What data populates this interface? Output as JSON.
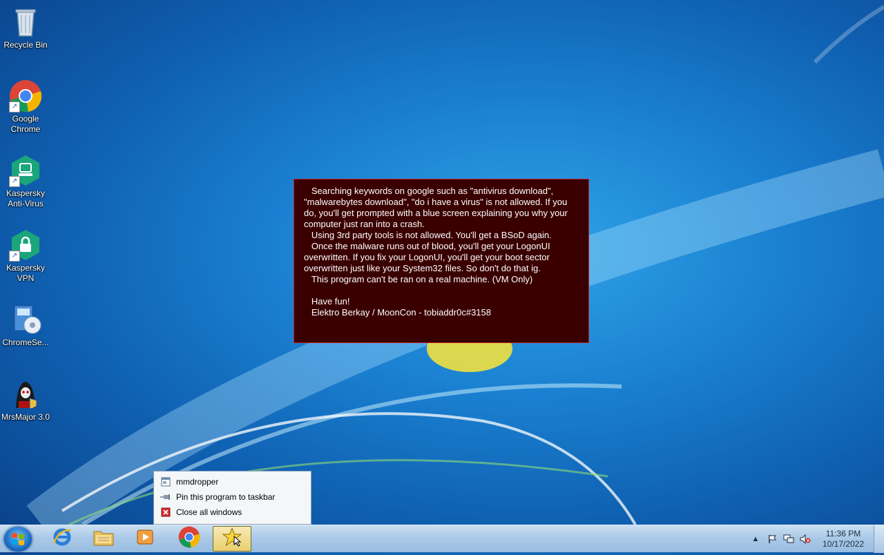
{
  "desktop": {
    "icons": [
      {
        "label": "Recycle Bin",
        "icon": "recycle-bin-icon"
      },
      {
        "label": "Google Chrome",
        "icon": "chrome-icon"
      },
      {
        "label": "Kaspersky Anti-Virus",
        "icon": "kaspersky-antivirus-icon"
      },
      {
        "label": "Kaspersky VPN",
        "icon": "kaspersky-vpn-icon"
      },
      {
        "label": "ChromeSe...",
        "icon": "installer-icon"
      },
      {
        "label": "MrsMajor 3.0",
        "icon": "mrsmajor-icon"
      }
    ]
  },
  "message": {
    "lines": [
      "   Searching keywords on google such as \"antivirus download\", \"malwarebytes download\", \"do i have a virus\" is not allowed. If you do, you'll get prompted with a blue screen explaining you why your computer just ran into a crash.",
      "   Using 3rd party tools is not allowed. You'll get a BSoD again.",
      "   Once the malware runs out of blood, you'll get your LogonUI overwritten. If you fix your LogonUI, you'll get your boot sector overwritten just like your System32 files. So don't do that ig.",
      "   This program can't be ran on a real machine. (VM Only)",
      "",
      "   Have fun!",
      "   Elektro Berkay / MoonCon - tobiaddr0c#3158"
    ]
  },
  "jumplist": {
    "items": [
      {
        "label": "mmdropper",
        "icon": "program-window-icon"
      },
      {
        "label": "Pin this program to taskbar",
        "icon": "pin-icon"
      },
      {
        "label": "Close all windows",
        "icon": "close-icon"
      }
    ]
  },
  "taskbar": {
    "buttons": [
      {
        "name": "internet-explorer",
        "icon": "internet-explorer-icon"
      },
      {
        "name": "windows-explorer",
        "icon": "folder-icon"
      },
      {
        "name": "media-player",
        "icon": "media-player-icon"
      },
      {
        "name": "google-chrome",
        "icon": "chrome-icon"
      },
      {
        "name": "mmdropper",
        "icon": "star-app-icon",
        "active": true
      }
    ],
    "clock": {
      "time": "11:36 PM",
      "date": "10/17/2022"
    }
  },
  "colors": {
    "message_bg": "#3a0000",
    "message_border": "#c02020",
    "taskbar": "#a9c8e6"
  }
}
